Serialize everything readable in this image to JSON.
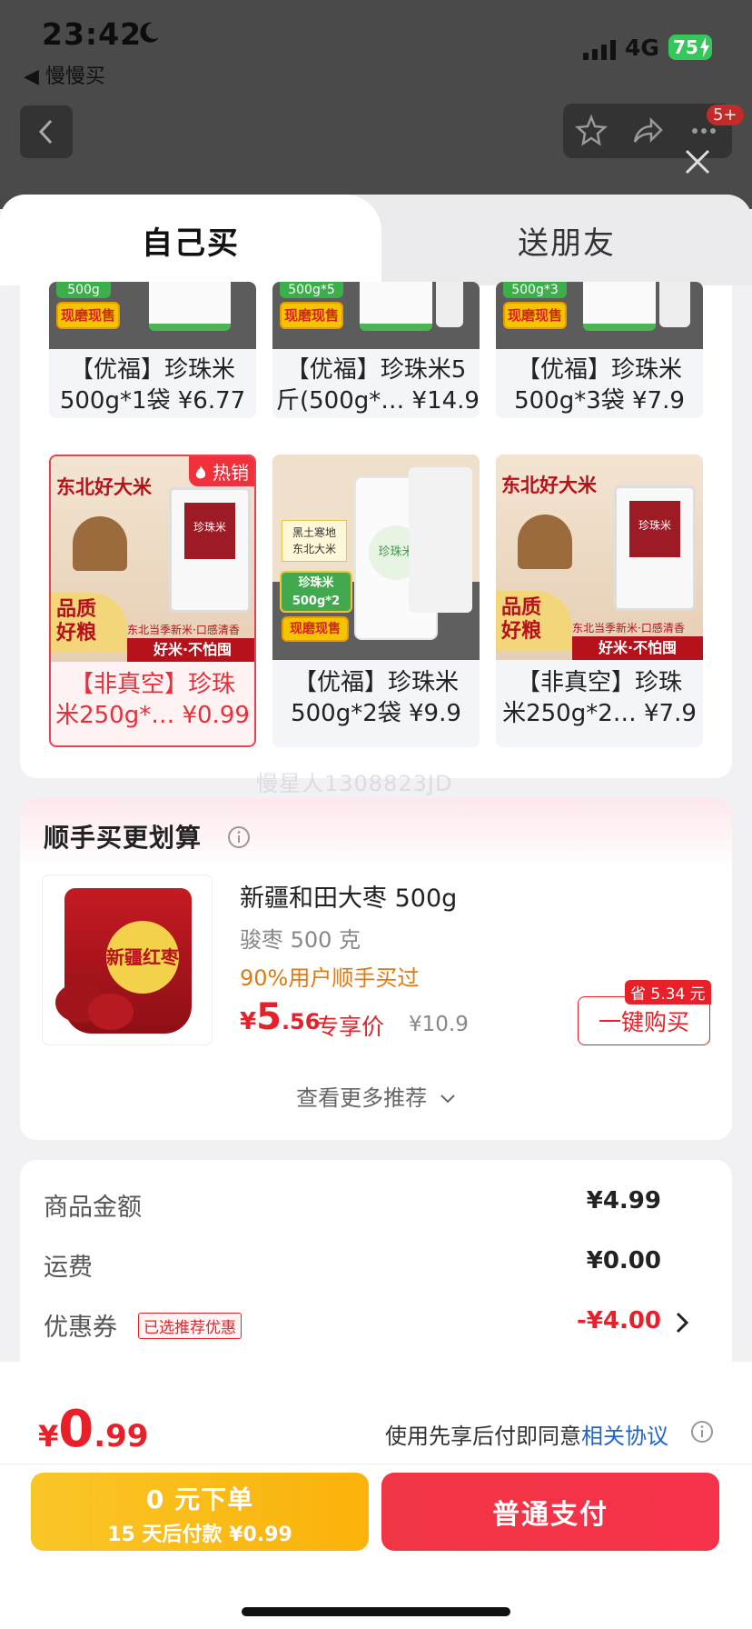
{
  "status_bar": {
    "time": "23:42",
    "back_app": "◀ 慢慢买",
    "network": "4G",
    "battery": "75"
  },
  "nav": {
    "badge": "5+"
  },
  "tabs": {
    "self_buy": "自己买",
    "gift_friend": "送朋友"
  },
  "products": [
    {
      "line1": "【优福】珍珠米",
      "line2": "500g*1袋 ¥6.77",
      "pack_label": "500g",
      "promo": "现磨现售"
    },
    {
      "line1": "【优福】珍珠米5",
      "line2": "斤(500g*… ¥14.9",
      "pack_label": "500g*5",
      "promo": "现磨现售"
    },
    {
      "line1": "【优福】珍珠米",
      "line2": "500g*3袋 ¥7.9",
      "pack_label": "500g*3",
      "promo": "现磨现售"
    },
    {
      "line1": "【非真空】珍珠",
      "line2": "米250g*… ¥0.99",
      "hot": "热销",
      "headline": "东北好大米",
      "slogan": "东北当季新米·口感清香",
      "quality": "品质\n好粮",
      "bottom_banner": "好米·不怕囤",
      "bag_label": "珍珠米"
    },
    {
      "line1": "【优福】珍珠米",
      "line2": "500g*2袋 ¥9.9",
      "box1": "黑土寒地\n东北大米",
      "box2": "珍珠米\n500g*2",
      "promo": "现磨现售",
      "bag_label": "珍珠米"
    },
    {
      "line1": "【非真空】珍珠",
      "line2": "米250g*2… ¥7.9",
      "headline": "东北好大米",
      "slogan": "东北当季新米·口感清香",
      "quality": "品质\n好粮",
      "bottom_banner": "好米·不怕囤",
      "bag_label": "珍珠米"
    }
  ],
  "watermark": "慢星人1308823JD",
  "addon": {
    "title": "顺手买更划算",
    "product_name": "新疆和田大枣 500g",
    "spec": "骏枣 500 克",
    "buyers": "90%用户顺手买过",
    "price_currency": "¥",
    "price_int": "5",
    "price_dec": ".56",
    "price_tag": "专享价",
    "original_price": "¥10.9",
    "save_badge": "省 5.34 元",
    "buy_button": "一键购买",
    "more": "查看更多推荐",
    "bag_text": "新疆红枣"
  },
  "summary": {
    "goods_label": "商品金额",
    "goods_value": "¥4.99",
    "shipping_label": "运费",
    "shipping_value": "¥0.00",
    "coupon_label": "优惠券",
    "coupon_badge": "已选推荐优惠",
    "coupon_value": "-¥4.00"
  },
  "checkout": {
    "total_currency": "¥",
    "total_int": "0",
    "total_dec": ".99",
    "agree_text": "使用先享后付即同意",
    "agree_link": "相关协议",
    "later_line1": "0 元下单",
    "later_line2": "15 天后付款 ¥0.99",
    "pay_button": "普通支付"
  }
}
